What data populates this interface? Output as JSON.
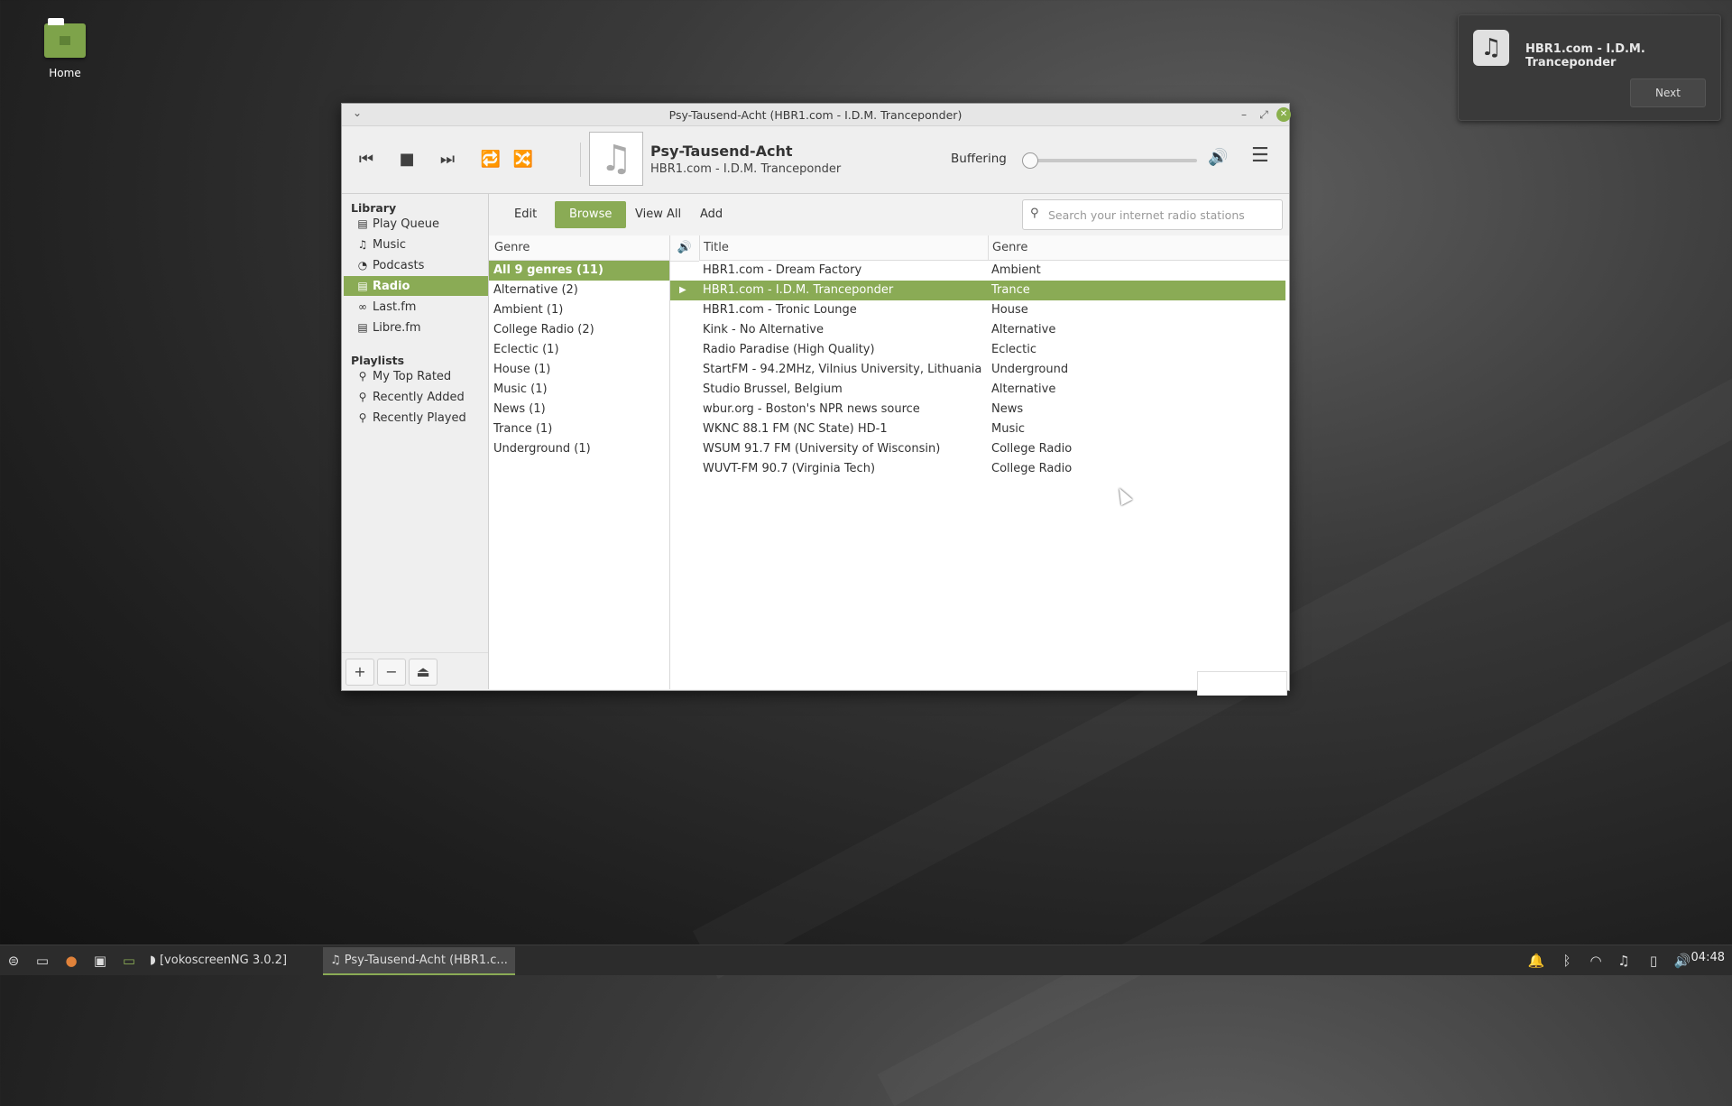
{
  "desktop": {
    "home_label": "Home"
  },
  "notification": {
    "title": "HBR1.com - I.D.M. Tranceponder",
    "next_label": "Next",
    "icon": "music-note-icon"
  },
  "window": {
    "title": "Psy-Tausend-Acht (HBR1.com - I.D.M. Tranceponder)"
  },
  "player": {
    "track_title": "Psy-Tausend-Acht",
    "station": "HBR1.com - I.D.M. Tranceponder",
    "status": "Buffering",
    "progress": 0
  },
  "sidebar": {
    "library_heading": "Library",
    "library_items": [
      {
        "label": "Play Queue",
        "icon": "document-icon"
      },
      {
        "label": "Music",
        "icon": "music-note-icon"
      },
      {
        "label": "Podcasts",
        "icon": "rss-icon"
      },
      {
        "label": "Radio",
        "icon": "radio-icon"
      },
      {
        "label": "Last.fm",
        "icon": "lastfm-icon"
      },
      {
        "label": "Libre.fm",
        "icon": "librefm-icon"
      }
    ],
    "playlists_heading": "Playlists",
    "playlist_items": [
      {
        "label": "My Top Rated",
        "icon": "search-icon"
      },
      {
        "label": "Recently Added",
        "icon": "search-icon"
      },
      {
        "label": "Recently Played",
        "icon": "search-icon"
      }
    ],
    "active_item": "Radio"
  },
  "tabs": [
    "Edit",
    "Browse",
    "View All",
    "Add"
  ],
  "active_tab": "Browse",
  "search": {
    "placeholder": "Search your internet radio stations",
    "value": ""
  },
  "genre_column": {
    "header": "Genre",
    "items": [
      "All 9 genres (11)",
      "Alternative (2)",
      "Ambient (1)",
      "College Radio (2)",
      "Eclectic (1)",
      "House (1)",
      "Music (1)",
      "News (1)",
      "Trance (1)",
      "Underground (1)"
    ]
  },
  "stations": {
    "headers": {
      "title": "Title",
      "genre": "Genre"
    },
    "rows": [
      {
        "title": "HBR1.com - Dream Factory",
        "genre": "Ambient"
      },
      {
        "title": "HBR1.com - I.D.M. Tranceponder",
        "genre": "Trance",
        "playing": true
      },
      {
        "title": "HBR1.com - Tronic Lounge",
        "genre": "House"
      },
      {
        "title": "Kink - No Alternative",
        "genre": "Alternative"
      },
      {
        "title": "Radio Paradise (High Quality)",
        "genre": "Eclectic"
      },
      {
        "title": "StartFM - 94.2MHz, Vilnius University, Lithuania",
        "genre": "Underground"
      },
      {
        "title": "Studio Brussel, Belgium",
        "genre": "Alternative"
      },
      {
        "title": "wbur.org - Boston's NPR news source",
        "genre": "News"
      },
      {
        "title": "WKNC 88.1 FM (NC State) HD-1",
        "genre": "Music"
      },
      {
        "title": "WSUM 91.7 FM (University of Wisconsin)",
        "genre": "College Radio"
      },
      {
        "title": "WUVT-FM 90.7 (Virginia Tech)",
        "genre": "College Radio"
      }
    ]
  },
  "taskbar": {
    "items": [
      {
        "label": "[vokoscreenNG 3.0.2]"
      },
      {
        "label": "Psy-Tausend-Acht (HBR1.c..."
      }
    ],
    "clock": "04:48"
  },
  "colors": {
    "accent": "#8aab55"
  }
}
